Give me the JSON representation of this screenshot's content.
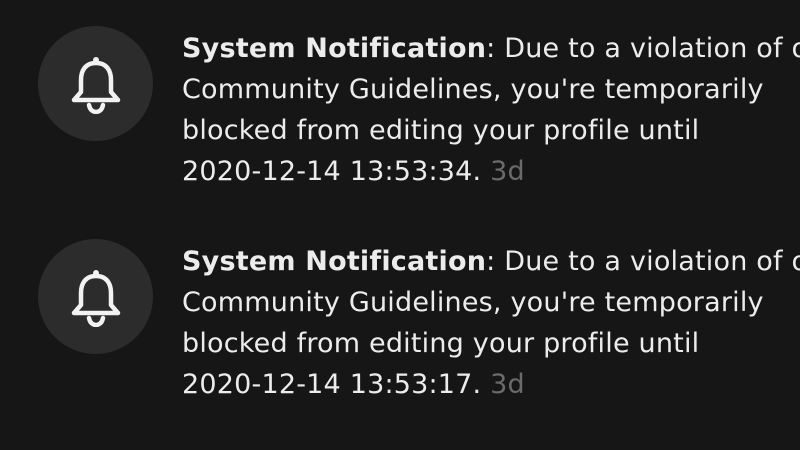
{
  "notifications": [
    {
      "icon": "bell-icon",
      "sender": "System Notification",
      "separator": ": ",
      "line1_rest": "Due to a violation of o",
      "line2": "Community Guidelines, you're temporarily",
      "line3": "blocked from editing your profile until",
      "line4": "2020-12-14 13:53:34.",
      "time": "3d"
    },
    {
      "icon": "bell-icon",
      "sender": "System Notification",
      "separator": ": ",
      "line1_rest": "Due to a violation of o",
      "line2": "Community Guidelines, you're temporarily",
      "line3": "blocked from editing your profile until",
      "line4": "2020-12-14 13:53:17.",
      "time": "3d"
    }
  ],
  "colors": {
    "background": "#161616",
    "avatar_bg": "#2c2c2c",
    "text": "#ececec",
    "time": "#6b6b6b"
  }
}
